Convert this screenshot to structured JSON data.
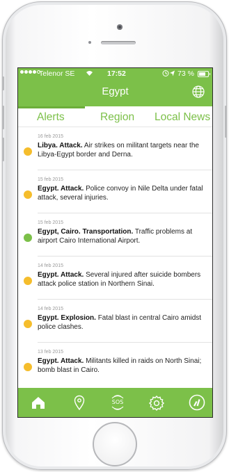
{
  "status_bar": {
    "carrier": "Telenor SE",
    "time": "17:52",
    "battery": "73 %",
    "battery_level": 0.73
  },
  "header": {
    "title": "Egypt",
    "globe_icon": "globe-icon"
  },
  "tabs": [
    {
      "label": "Alerts",
      "active": true
    },
    {
      "label": "Region",
      "active": false
    },
    {
      "label": "Local News",
      "active": false
    }
  ],
  "alerts": [
    {
      "date": "16 feb 2015",
      "heading": "Libya. Attack.",
      "body": "Air strikes on militant targets near the Libya-Egypt border and Derna.",
      "level": "medium"
    },
    {
      "date": "15 feb 2015",
      "heading": "Egypt. Attack.",
      "body": "Police convoy in Nile Delta under fatal attack, several injuries.",
      "level": "medium"
    },
    {
      "date": "15 feb 2015",
      "heading": "Egypt, Cairo. Transportation.",
      "body": "Traffic problems at airport Cairo International Airport.",
      "level": "low"
    },
    {
      "date": "14 feb 2015",
      "heading": "Egypt. Attack.",
      "body": "Several injured after suicide bombers attack police station in Northern Sinai.",
      "level": "medium"
    },
    {
      "date": "14 feb 2015",
      "heading": "Egypt. Explosion.",
      "body": "Fatal blast in central Cairo amidst police clashes.",
      "level": "medium"
    },
    {
      "date": "13 feb 2015",
      "heading": "Egypt. Attack.",
      "body": "Militants killed in raids on North Sinai; bomb blast in Cairo.",
      "level": "medium"
    }
  ],
  "level_colors": {
    "medium": "#f5bd2c",
    "low": "#7cc049"
  },
  "accent_color": "#7cc049",
  "bottom_nav": {
    "home_icon": "home-icon",
    "map_pin_icon": "map-pin-icon",
    "sos_label": "SOS",
    "settings_icon": "gear-icon",
    "gauge_icon": "gauge-icon"
  }
}
